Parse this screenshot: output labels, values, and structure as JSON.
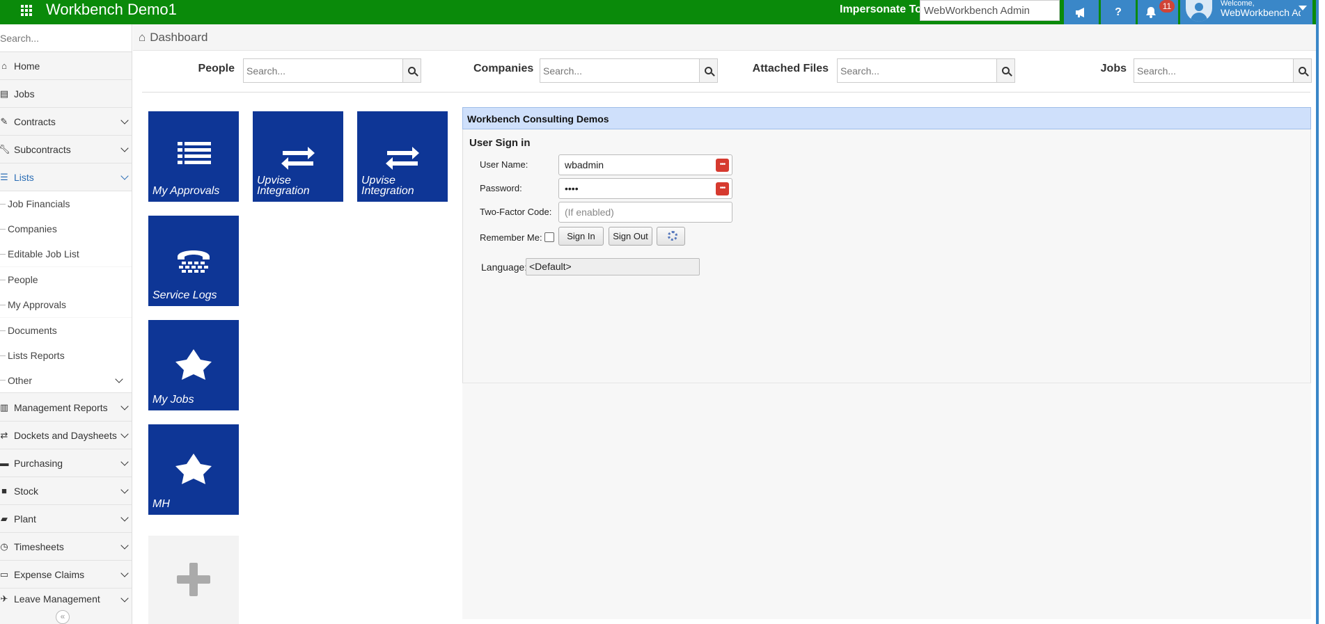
{
  "topbar": {
    "title": "Workbench Demo1",
    "impersonate_label": "Impersonate To",
    "impersonate_value": "WebWorkbench Admin",
    "help_label": "?",
    "notification_count": "11",
    "welcome_line1": "Welcome,",
    "welcome_line2": "WebWorkbench Admin"
  },
  "sidebar": {
    "search_placeholder": "Search...",
    "items": [
      {
        "label": "Home",
        "icon": "home-icon"
      },
      {
        "label": "Jobs",
        "icon": "jobs-icon"
      },
      {
        "label": "Contracts",
        "icon": "edit-icon"
      },
      {
        "label": "Subcontracts",
        "icon": "wrench-icon"
      },
      {
        "label": "Lists",
        "icon": "list-icon"
      },
      {
        "label": "Management Reports",
        "icon": "bar-chart-icon"
      },
      {
        "label": "Dockets and Daysheets",
        "icon": "exchange-icon"
      },
      {
        "label": "Purchasing",
        "icon": "truck-icon"
      },
      {
        "label": "Stock",
        "icon": "box-icon"
      },
      {
        "label": "Plant",
        "icon": "truck-icon"
      },
      {
        "label": "Timesheets",
        "icon": "clock-icon"
      },
      {
        "label": "Expense Claims",
        "icon": "money-icon"
      },
      {
        "label": "Leave Management",
        "icon": "plane-icon"
      }
    ],
    "list_subitems": [
      "Job Financials",
      "Companies",
      "Editable Job List",
      "People",
      "My Approvals",
      "Documents",
      "Lists Reports",
      "Other"
    ]
  },
  "breadcrumb": {
    "title": "Dashboard"
  },
  "search_row": [
    {
      "label": "People",
      "placeholder": "Search..."
    },
    {
      "label": "Companies",
      "placeholder": "Search..."
    },
    {
      "label": "Attached Files",
      "placeholder": "Search..."
    },
    {
      "label": "Jobs",
      "placeholder": "Search..."
    }
  ],
  "tiles": [
    {
      "label": "My Approvals",
      "icon": "list-icon"
    },
    {
      "label": "Upvise Integration",
      "icon": "exchange-icon"
    },
    {
      "label": "Upvise Integration",
      "icon": "exchange-icon"
    },
    {
      "label": "Service Logs",
      "icon": "phone-icon"
    },
    {
      "label": "My Jobs",
      "icon": "star-icon"
    },
    {
      "label": "MH",
      "icon": "star-icon"
    },
    {
      "label": "",
      "icon": "plus-icon"
    }
  ],
  "panel": {
    "title": "Workbench Consulting Demos",
    "signin_title": "User Sign in",
    "username_label": "User Name:",
    "username_value": "wbadmin",
    "password_label": "Password:",
    "password_value": "••••",
    "twofactor_label": "Two-Factor Code:",
    "twofactor_placeholder": "(If enabled)",
    "remember_label": "Remember Me:",
    "signin_button": "Sign In",
    "signout_button": "Sign Out",
    "language_label": "Language:",
    "language_value": "<Default>"
  },
  "colors": {
    "topbar": "#0a8a0a",
    "accent": "#3a87c8",
    "tile": "#0e3696",
    "badge": "#d04437"
  }
}
